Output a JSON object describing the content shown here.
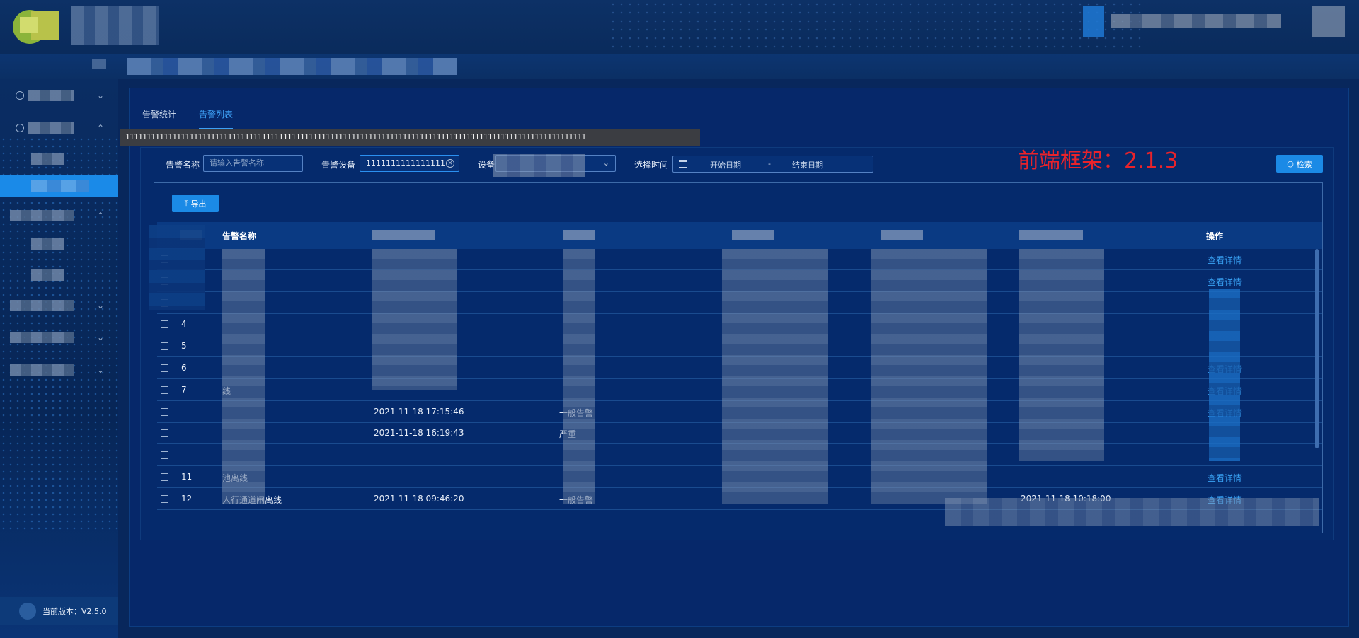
{
  "version": {
    "label": "当前版本：V2.5.0"
  },
  "tabs": [
    {
      "label": "告警统计",
      "active": false
    },
    {
      "label": "告警列表",
      "active": true
    }
  ],
  "tooltip": {
    "text": "111111111111111111111111111111111111111111111111111111111111111111111111111111111111111111111111111111111111"
  },
  "filters": {
    "alarm_name_label": "告警名称",
    "alarm_name_placeholder": "请输入告警名称",
    "alarm_device_label": "告警设备",
    "alarm_device_value": "1111111111111111",
    "device_label": "设备",
    "time_label": "选择时间",
    "start_placeholder": "开始日期",
    "range_sep": "-",
    "end_placeholder": "结束日期",
    "search_button": "检索"
  },
  "frontend_note": "前端框架：2.1.3",
  "export_button": "导出",
  "table": {
    "headers": {
      "name": "告警名称",
      "op": "操作"
    },
    "rows": [
      {
        "index": "",
        "name": "",
        "time": "",
        "level": "",
        "end": "",
        "op": "查看详情"
      },
      {
        "index": "",
        "name": "",
        "time": "",
        "level": "",
        "end": "",
        "op": "查看详情"
      },
      {
        "index": "",
        "name": "",
        "time": "",
        "level": "",
        "end": "",
        "op": ""
      },
      {
        "index": "4",
        "name": "",
        "time": "",
        "level": "",
        "end": "",
        "op": ""
      },
      {
        "index": "5",
        "name": "",
        "time": "",
        "level": "",
        "end": "",
        "op": ""
      },
      {
        "index": "6",
        "name": "",
        "time": "",
        "level": "",
        "end": "",
        "op": "查看详情"
      },
      {
        "index": "7",
        "name": "线",
        "time": "",
        "level": "",
        "end": "",
        "op": "查看详情"
      },
      {
        "index": "",
        "name": "",
        "time": "2021-11-18 17:15:46",
        "level": "一般告警",
        "end": "",
        "op": "查看详情"
      },
      {
        "index": "",
        "name": "",
        "time": "2021-11-18 16:19:43",
        "level": "严重",
        "end": "",
        "op": ""
      },
      {
        "index": "",
        "name": "",
        "time": "",
        "level": "",
        "end": "",
        "op": ""
      },
      {
        "index": "11",
        "name": "池离线",
        "time": "",
        "level": "",
        "end": "",
        "op": "查看详情"
      },
      {
        "index": "12",
        "name": "人行通道闸离线",
        "time": "2021-11-18 09:46:20",
        "level": "一般告警",
        "end": "2021-11-18 10:18:00",
        "op": "查看详情"
      }
    ]
  },
  "colors": {
    "accent": "#1b8ae6",
    "link": "#39a2f4",
    "note_red": "#e9232b"
  }
}
